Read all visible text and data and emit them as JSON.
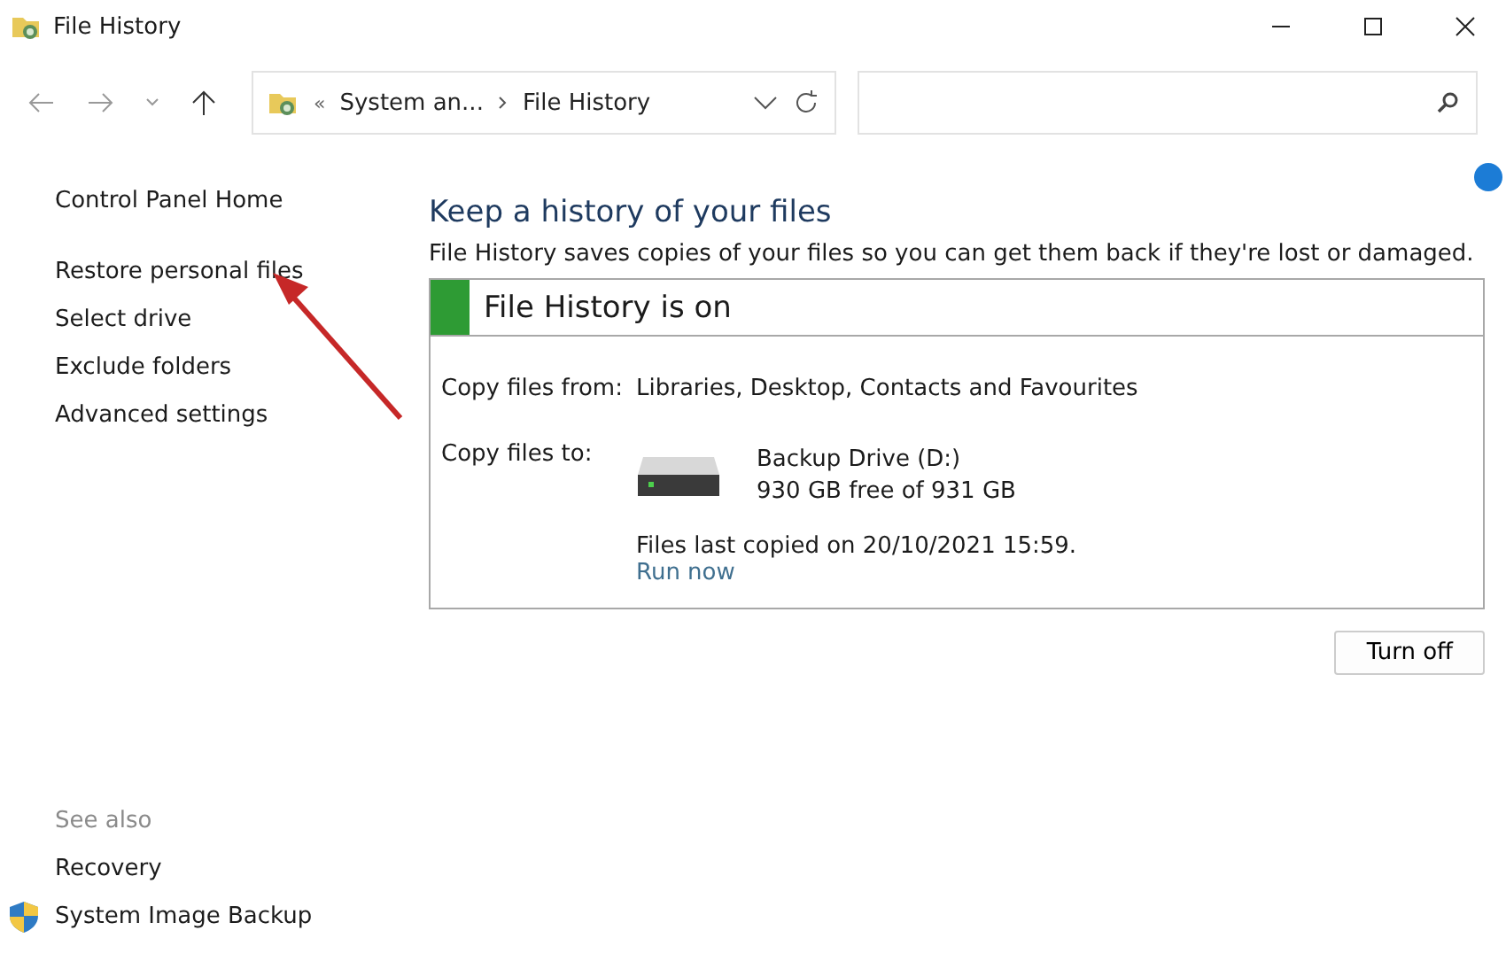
{
  "window": {
    "title": "File History"
  },
  "address_bar": {
    "overflow": "«",
    "path": [
      {
        "label": "System an..."
      },
      {
        "label": "File History"
      }
    ]
  },
  "sidebar": {
    "items": [
      {
        "label": "Control Panel Home",
        "kind": "home"
      },
      {
        "label": "Restore personal files",
        "kind": "task"
      },
      {
        "label": "Select drive",
        "kind": "task"
      },
      {
        "label": "Exclude folders",
        "kind": "task"
      },
      {
        "label": "Advanced settings",
        "kind": "task"
      }
    ],
    "see_also": {
      "heading": "See also",
      "items": [
        {
          "label": "Recovery",
          "icon": false
        },
        {
          "label": "System Image Backup",
          "icon": true
        }
      ]
    }
  },
  "main": {
    "title": "Keep a history of your files",
    "description": "File History saves copies of your files so you can get them back if they're lost or damaged.",
    "status": {
      "label": "File History is on",
      "on": true
    },
    "copy_from": {
      "label": "Copy files from:",
      "value": "Libraries, Desktop, Contacts and Favourites"
    },
    "copy_to": {
      "label": "Copy files to:",
      "drive_name": "Backup Drive (D:)",
      "drive_space": "930 GB free of 931 GB"
    },
    "last_copied": "Files last copied on 20/10/2021 15:59.",
    "run_now": "Run now",
    "button": "Turn off"
  },
  "annotation": {
    "kind": "arrow"
  }
}
